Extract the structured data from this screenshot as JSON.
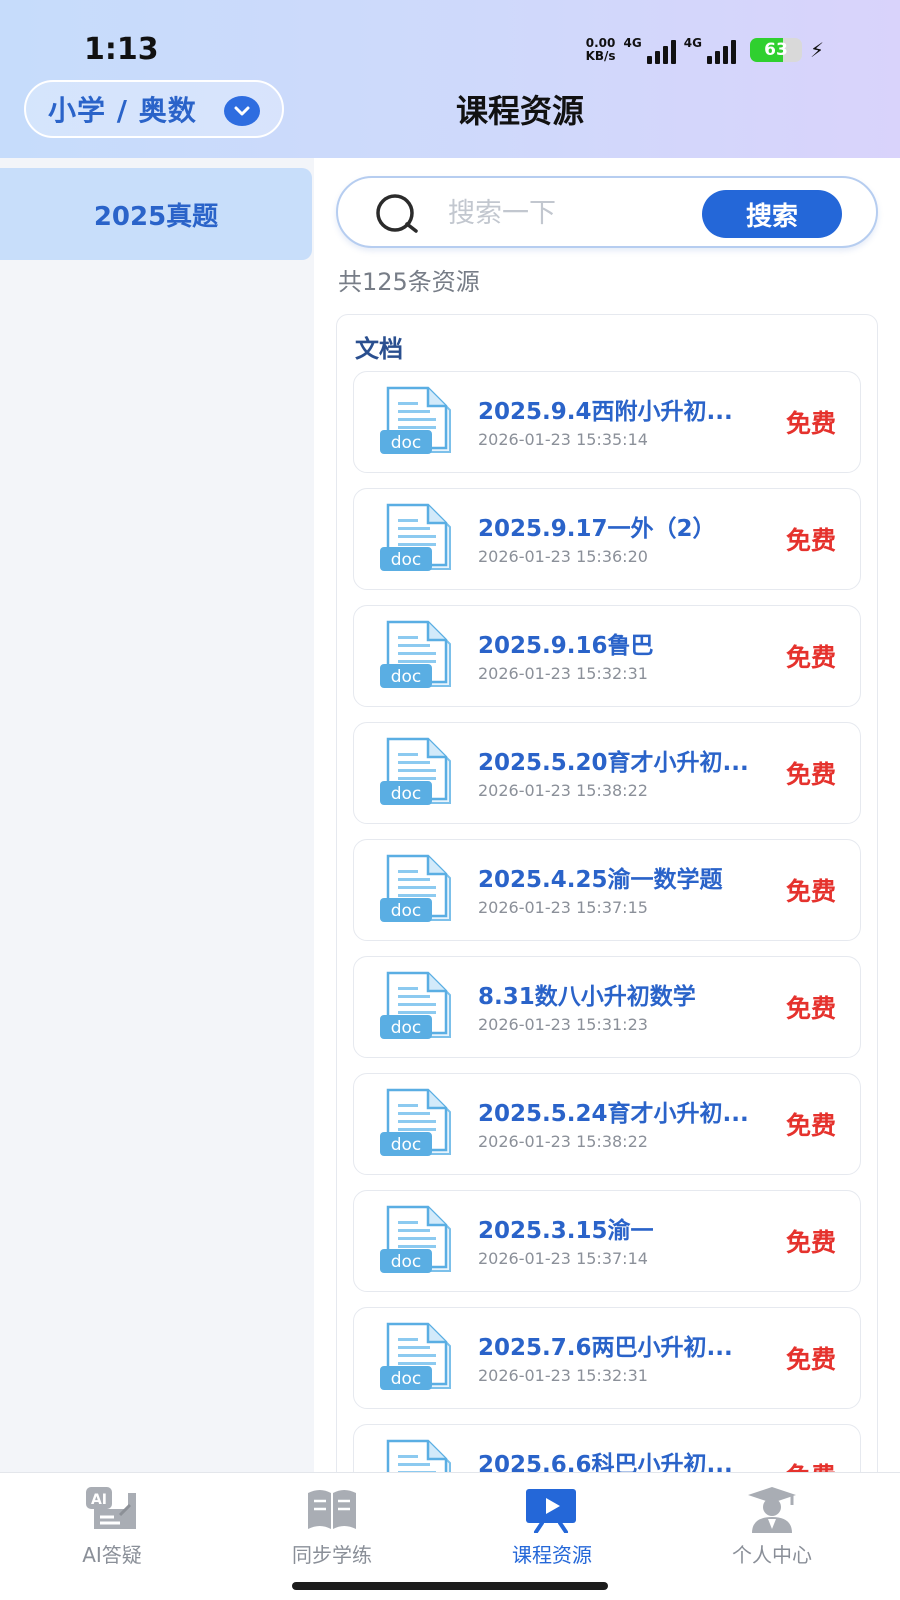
{
  "status_bar": {
    "time": "1:13",
    "net_speed_value": "0.00",
    "net_speed_unit": "KB/s",
    "signal1_label": "4G",
    "signal2_label": "4G",
    "battery_level": 63,
    "battery_text": "63"
  },
  "header": {
    "subject_picker": "小学 / 奥数",
    "title": "课程资源"
  },
  "sidebar": {
    "items": [
      {
        "label": "2025真题",
        "selected": true
      }
    ]
  },
  "search": {
    "placeholder": "搜索一下",
    "value": "",
    "button_label": "搜索"
  },
  "result_count": "共125条资源",
  "section": {
    "title": "文档",
    "file_type_label": "doc",
    "items": [
      {
        "title": "2025.9.4西附小升初...",
        "time": "2026-01-23 15:35:14",
        "price": "免费"
      },
      {
        "title": "2025.9.17一外（2）",
        "time": "2026-01-23 15:36:20",
        "price": "免费"
      },
      {
        "title": "2025.9.16鲁巴",
        "time": "2026-01-23 15:32:31",
        "price": "免费"
      },
      {
        "title": "2025.5.20育才小升初...",
        "time": "2026-01-23 15:38:22",
        "price": "免费"
      },
      {
        "title": "2025.4.25渝一数学题",
        "time": "2026-01-23 15:37:15",
        "price": "免费"
      },
      {
        "title": "8.31数八小升初数学",
        "time": "2026-01-23 15:31:23",
        "price": "免费"
      },
      {
        "title": "2025.5.24育才小升初...",
        "time": "2026-01-23 15:38:22",
        "price": "免费"
      },
      {
        "title": "2025.3.15渝一",
        "time": "2026-01-23 15:37:14",
        "price": "免费"
      },
      {
        "title": "2025.7.6两巴小升初...",
        "time": "2026-01-23 15:32:31",
        "price": "免费"
      },
      {
        "title": "2025.6.6科巴小升初...",
        "time": "",
        "price": "免费"
      }
    ]
  },
  "bottom_nav": [
    {
      "label": "AI答疑",
      "icon": "ai-answer-icon",
      "icon_text": "AI",
      "active": false
    },
    {
      "label": "同步学练",
      "icon": "book-icon",
      "active": false
    },
    {
      "label": "课程资源",
      "icon": "video-board-icon",
      "active": true
    },
    {
      "label": "个人中心",
      "icon": "user-graduate-icon",
      "active": false
    }
  ],
  "colors": {
    "accent": "#2467d8",
    "title_blue": "#2a63c9",
    "price_red": "#e5322d",
    "doc_icon": "#5aaee3",
    "sidebar_selected": "#c8defa"
  }
}
